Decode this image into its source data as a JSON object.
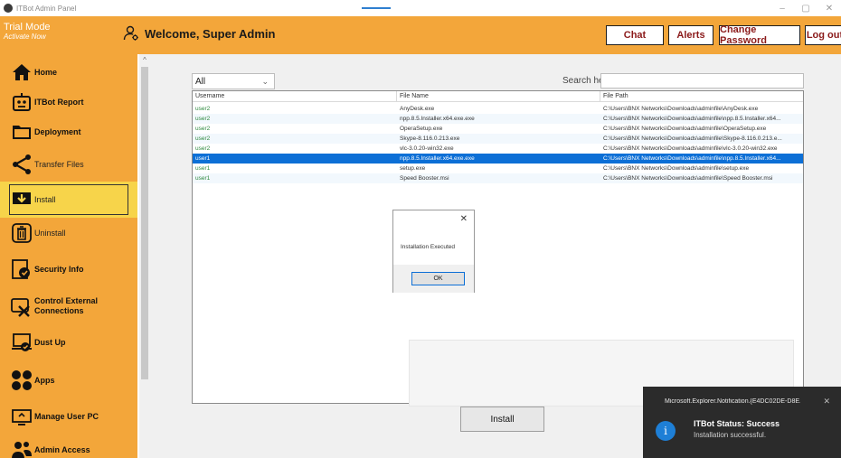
{
  "window": {
    "title": "ITBot Admin Panel",
    "controls": [
      "–",
      "▢",
      "✕"
    ]
  },
  "header": {
    "trial_mode": "Trial Mode",
    "activate_now": "Activate Now",
    "welcome": "Welcome, Super Admin",
    "buttons": {
      "chat": "Chat",
      "alerts": "Alerts",
      "change_password": "Change Password",
      "logout": "Log out"
    }
  },
  "sidebar": {
    "items": [
      {
        "label": "Home",
        "icon": "home-icon"
      },
      {
        "label": "ITBot Report",
        "icon": "robot-icon"
      },
      {
        "label": "Deployment",
        "icon": "folder-icon"
      },
      {
        "label": "Transfer Files",
        "icon": "share-icon"
      },
      {
        "label": "Install",
        "icon": "install-icon"
      },
      {
        "label": "Uninstall",
        "icon": "trash-icon"
      },
      {
        "label": "Security Info",
        "icon": "security-icon"
      },
      {
        "label": "Control External",
        "label2": "Connections",
        "icon": "usb-icon"
      },
      {
        "label": "Dust Up",
        "icon": "laptop-icon"
      },
      {
        "label": "Apps",
        "icon": "apps-icon"
      },
      {
        "label": "Manage User PC",
        "icon": "monitor-icon"
      },
      {
        "label": "Admin Access",
        "icon": "users-icon"
      }
    ],
    "active_index": 4
  },
  "filter": {
    "selected": "All"
  },
  "search": {
    "label": "Search here..."
  },
  "table": {
    "columns": [
      "Username",
      "File Name",
      "File Path"
    ],
    "rows": [
      {
        "user": "user2",
        "file": "AnyDesk.exe",
        "path": "C:\\Users\\BNX Networks\\Downloads\\adminfile\\AnyDesk.exe"
      },
      {
        "user": "user2",
        "file": "npp.8.5.Installer.x64.exe.exe",
        "path": "C:\\Users\\BNX Networks\\Downloads\\adminfile\\npp.8.5.Installer.x64..."
      },
      {
        "user": "user2",
        "file": "OperaSetup.exe",
        "path": "C:\\Users\\BNX Networks\\Downloads\\adminfile\\OperaSetup.exe"
      },
      {
        "user": "user2",
        "file": "Skype-8.116.0.213.exe",
        "path": "C:\\Users\\BNX Networks\\Downloads\\adminfile\\Skype-8.116.0.213.e..."
      },
      {
        "user": "user2",
        "file": "vlc-3.0.20-win32.exe",
        "path": "C:\\Users\\BNX Networks\\Downloads\\adminfile\\vlc-3.0.20-win32.exe"
      },
      {
        "user": "user1",
        "file": "npp.8.5.Installer.x64.exe.exe",
        "path": "C:\\Users\\BNX Networks\\Downloads\\adminfile\\npp.8.5.Installer.x64..."
      },
      {
        "user": "user1",
        "file": "setup.exe",
        "path": "C:\\Users\\BNX Networks\\Downloads\\adminfile\\setup.exe"
      },
      {
        "user": "user1",
        "file": "Speed Booster.msi",
        "path": "C:\\Users\\BNX Networks\\Downloads\\adminfile\\Speed Booster.msi"
      }
    ],
    "selected_index": 5
  },
  "dialog": {
    "message": "Installation Executed",
    "ok": "OK",
    "close": "✕"
  },
  "install_button": "Install",
  "toast": {
    "source": "Microsoft.Explorer.Notification.{E4DC02DE-D8E...",
    "title": "ITBot Status: Success",
    "body": "Installation successful.",
    "close": "✕",
    "info_glyph": "i"
  },
  "colors": {
    "accent": "#f3a63a",
    "active_item": "#f7d44a",
    "selected_row": "#0c6fd6",
    "username": "#2f8a3f",
    "button_text": "#8b1a1a"
  }
}
